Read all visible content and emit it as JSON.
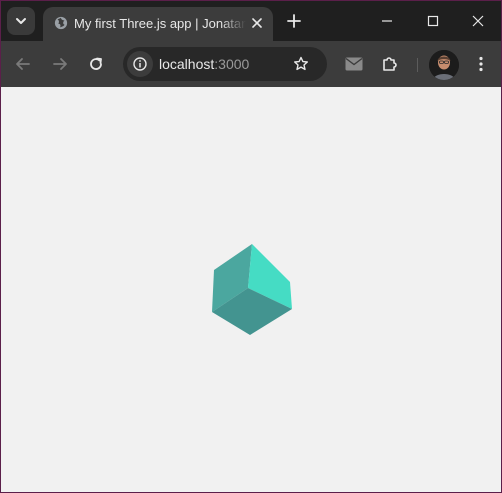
{
  "tab": {
    "title": "My first Three.js app | Jonatandb",
    "favicon": "globe-icon",
    "close_icon": "close-icon"
  },
  "tabstrip": {
    "tab_search_icon": "chevron-down-icon",
    "new_tab_icon": "plus-icon"
  },
  "window_controls": {
    "minimize_icon": "minimize-icon",
    "maximize_icon": "maximize-icon",
    "close_icon": "close-icon"
  },
  "toolbar": {
    "back_icon": "arrow-left-icon",
    "forward_icon": "arrow-right-icon",
    "reload_icon": "reload-icon",
    "site_info_icon": "info-icon",
    "bookmark_icon": "star-icon",
    "mail_icon": "mail-icon",
    "extensions_icon": "puzzle-icon",
    "menu_icon": "kebab-menu-icon"
  },
  "address": {
    "host": "localhost",
    "port": ":3000"
  },
  "scene": {
    "background": "#f1f1f1",
    "cube_top_color": "#4ba79f",
    "cube_right_color": "#45dcc4",
    "cube_left_color": "#4d9f9b",
    "cube_front_color": "#439490"
  },
  "colors": {
    "tabstrip_bg": "#1f1f1f",
    "toolbar_bg": "#3c3c3c",
    "window_border": "#5b1f4a"
  }
}
